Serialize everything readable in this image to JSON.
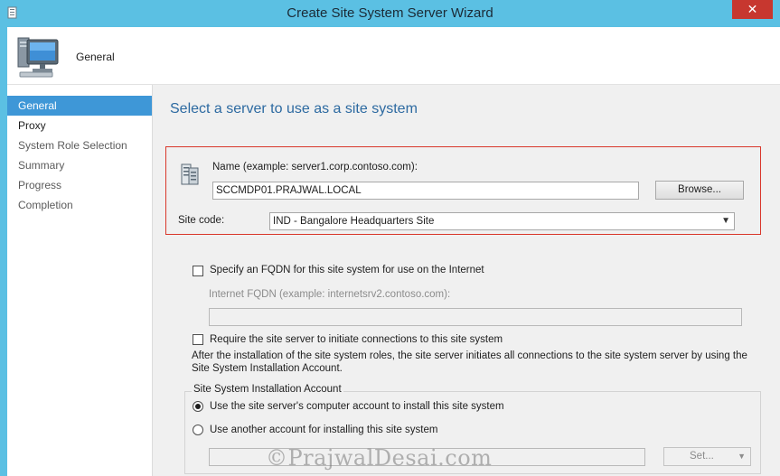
{
  "window": {
    "title": "Create Site System Server Wizard",
    "close_symbol": "✕"
  },
  "header": {
    "title": "General"
  },
  "nav": {
    "items": [
      {
        "label": "General"
      },
      {
        "label": "Proxy"
      },
      {
        "label": "System Role Selection"
      },
      {
        "label": "Summary"
      },
      {
        "label": "Progress"
      },
      {
        "label": "Completion"
      }
    ]
  },
  "content": {
    "heading": "Select a server to use as a site system",
    "name_label": "Name (example: server1.corp.contoso.com):",
    "name_value": "SCCMDP01.PRAJWAL.LOCAL",
    "browse_label": "Browse...",
    "site_code_label": "Site code:",
    "site_code_value": "IND - Bangalore Headquarters Site",
    "fqdn_checkbox_label": "Specify an FQDN for this site system for use on the Internet",
    "fqdn_checked": false,
    "internet_fqdn_label": "Internet FQDN (example: internetsrv2.contoso.com):",
    "require_checkbox_label": "Require the site server to initiate connections to this site system",
    "require_checked": false,
    "description": "After the  installation of the site system roles, the site server initiates all connections to the site system server by using the Site System Installation Account.",
    "install_account_group": "Site System Installation Account",
    "radio_computer_account": "Use the site server's computer account to install this site system",
    "radio_another_account": "Use another account for installing this site system",
    "set_label": "Set..."
  },
  "watermark": "©PrajwalDesai.com",
  "colors": {
    "titlebar": "#5bc0e3",
    "nav_selected": "#3e97d7",
    "heading": "#2d6aa1",
    "highlight_box": "#d9372b"
  }
}
